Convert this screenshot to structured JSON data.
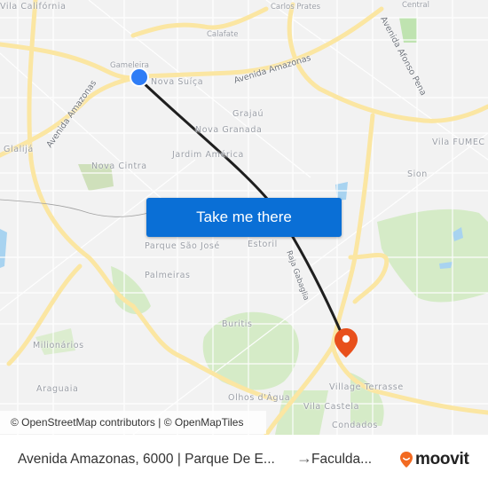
{
  "map": {
    "place_labels": [
      {
        "id": "vila-california",
        "text": "Vila Califórnia"
      },
      {
        "id": "carlos-prates",
        "text": "Carlos Prates"
      },
      {
        "id": "central",
        "text": "Central"
      },
      {
        "id": "calafate",
        "text": "Calafate"
      },
      {
        "id": "gameleira",
        "text": "Gameleira"
      },
      {
        "id": "nova-suica",
        "text": "Nova Suíça"
      },
      {
        "id": "grajau",
        "text": "Grajaú"
      },
      {
        "id": "nova-granada",
        "text": "Nova Granada"
      },
      {
        "id": "jardim-america",
        "text": "Jardim América"
      },
      {
        "id": "vila-fumec",
        "text": "Vila FUMEC"
      },
      {
        "id": "glalija",
        "text": "Glalijá"
      },
      {
        "id": "nova-cintra",
        "text": "Nova Cintra"
      },
      {
        "id": "sion",
        "text": "Sion"
      },
      {
        "id": "parque-sao-jose",
        "text": "Parque São José"
      },
      {
        "id": "estoril",
        "text": "Estoril"
      },
      {
        "id": "palmeiras",
        "text": "Palmeiras"
      },
      {
        "id": "buritis",
        "text": "Buritis"
      },
      {
        "id": "milionarios",
        "text": "Milionários"
      },
      {
        "id": "araguaia",
        "text": "Araguaia"
      },
      {
        "id": "olhos-dagua",
        "text": "Olhos d'Água"
      },
      {
        "id": "village-terrasse",
        "text": "Village Terrasse"
      },
      {
        "id": "vila-castela",
        "text": "Vila Castela"
      },
      {
        "id": "condados",
        "text": "Condados"
      }
    ],
    "street_labels": [
      {
        "id": "avenida-amazonas-east",
        "text": "Avenida Amazonas"
      },
      {
        "id": "avenida-amazonas-west",
        "text": "Avenida Amazonas"
      },
      {
        "id": "avenida-afonso-pena",
        "text": "Avenida Afonso Pena"
      },
      {
        "id": "raja-gabaglia",
        "text": "Raja Gabaglia"
      }
    ],
    "origin_marker": {
      "label": "origin-stop",
      "color": "#2f7df6"
    },
    "destination_marker": {
      "label": "destination",
      "color": "#e8501c"
    },
    "route_color": "#1f1f1f",
    "cta_label": "Take me there",
    "cta_color": "#0a6fd6",
    "attribution": "© OpenStreetMap contributors | © OpenMapTiles"
  },
  "footer": {
    "origin": "Avenida Amazonas, 6000 | Parque De E...",
    "arrow": "→",
    "destination": "Faculda...",
    "brand": "moovit",
    "brand_color": "#f26a21"
  }
}
